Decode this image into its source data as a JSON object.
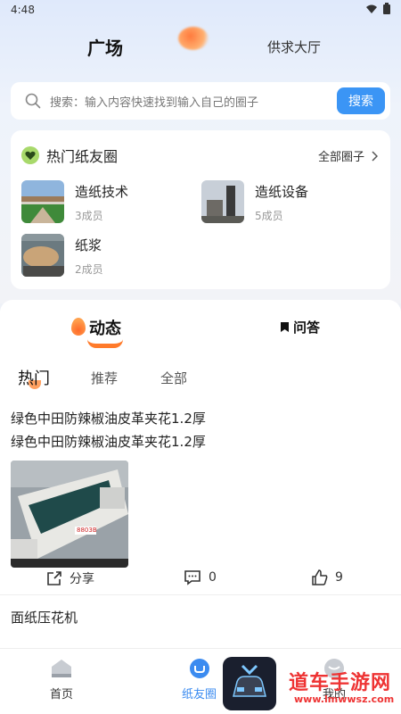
{
  "status": {
    "time": "4:48"
  },
  "header": {
    "tab_main": "广场",
    "tab_supply": "供求大厅"
  },
  "search": {
    "placeholder": "搜索：输入内容快速找到输入自己的圈子",
    "button": "搜索"
  },
  "hot_circles": {
    "title": "热门纸友圈",
    "all_link": "全部圈子",
    "items": [
      {
        "name": "造纸技术",
        "members": "3成员"
      },
      {
        "name": "造纸设备",
        "members": "5成员"
      },
      {
        "name": "纸浆",
        "members": "2成员"
      }
    ]
  },
  "feed": {
    "tab_dynamic": "动态",
    "tab_qa": "问答",
    "sub_tabs": [
      "热门",
      "推荐",
      "全部"
    ],
    "posts": [
      {
        "line1": "绿色中田防辣椒油皮革夹花1.2厚",
        "line2": "绿色中田防辣椒油皮革夹花1.2厚",
        "image_label": "8803B",
        "share": "分享",
        "comments": "0",
        "likes": "9"
      },
      {
        "line1": "面纸压花机"
      }
    ]
  },
  "bottom_nav": {
    "home": "首页",
    "circle": "纸友圈",
    "mine": "我的"
  },
  "watermark": {
    "title": "道车手游网",
    "url": "www.lmwwsz.com"
  },
  "colors": {
    "accent": "#3b95f5",
    "orange": "#ff7a2a",
    "green_badge": "#a8d96b"
  }
}
